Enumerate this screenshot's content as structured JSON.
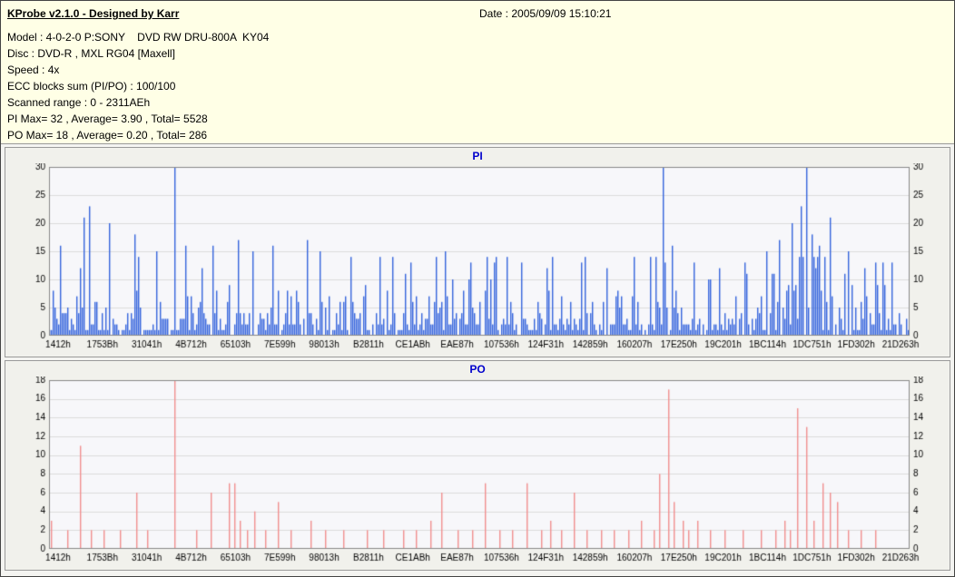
{
  "header": {
    "app_title": "KProbe v2.1.0 - Designed by Karr",
    "date_label": "Date : 2005/09/09 15:10:21",
    "info": [
      "Model : 4-0-2-0 P:SONY    DVD RW DRU-800A  KY04",
      "Disc : DVD-R , MXL RG04 [Maxell]",
      "Speed : 4x",
      "ECC blocks sum (PI/PO) : 100/100",
      "Scanned range : 0 - 2311AEh",
      "PI Max= 32 , Average= 3.90 , Total= 5528",
      "PO Max= 18 , Average= 0.20 , Total= 286"
    ]
  },
  "colors": {
    "header_bg": "#ffffe6",
    "panel_bg": "#f1f1ec",
    "chart_title": "#0000cc",
    "pi_bars": "#3565dd",
    "po_bars": "#f28f8f",
    "grid": "#dcdcdc",
    "plot_bg": "#f7f7fa"
  },
  "chart_data": [
    {
      "id": "pi",
      "type": "bar",
      "title": "PI",
      "ylim": [
        0,
        30
      ],
      "yticks": [
        0,
        5,
        10,
        15,
        20,
        25,
        30
      ],
      "x_tick_labels": [
        "1412h",
        "1753Bh",
        "31041h",
        "4B712h",
        "65103h",
        "7E599h",
        "98013h",
        "B2811h",
        "CE1ABh",
        "EAE87h",
        "107536h",
        "124F31h",
        "142859h",
        "160207h",
        "17E250h",
        "19C201h",
        "1BC114h",
        "1DC751h",
        "1FD302h",
        "21D263h"
      ],
      "stats": {
        "max": 32,
        "average": 3.9,
        "total": 5528
      },
      "bar_color": "#3565dd",
      "plot_bg": "#f7f7fa",
      "grid_color": "#dcdcdc",
      "grid": "horizontal",
      "legend": "none",
      "render": {
        "mode": "noise",
        "seed": 1337,
        "bar_pitch": 2,
        "noise_mean": 3.6,
        "noise_clamp": 14,
        "regions": [
          {
            "from": 0.0,
            "to": 0.06,
            "gain": 1.3
          },
          {
            "from": 0.08,
            "to": 0.13,
            "gain": 1.2
          },
          {
            "from": 0.695,
            "to": 0.735,
            "gain": 1.3
          },
          {
            "from": 0.84,
            "to": 0.94,
            "gain": 1.6
          }
        ]
      },
      "spikes": [
        [
          0.012,
          16
        ],
        [
          0.04,
          21
        ],
        [
          0.046,
          23
        ],
        [
          0.07,
          20
        ],
        [
          0.1,
          18
        ],
        [
          0.125,
          15
        ],
        [
          0.145,
          32
        ],
        [
          0.158,
          16
        ],
        [
          0.19,
          16
        ],
        [
          0.22,
          17
        ],
        [
          0.236,
          15
        ],
        [
          0.26,
          16
        ],
        [
          0.3,
          17
        ],
        [
          0.316,
          15
        ],
        [
          0.35,
          14
        ],
        [
          0.4,
          14
        ],
        [
          0.42,
          13
        ],
        [
          0.46,
          15
        ],
        [
          0.49,
          13
        ],
        [
          0.52,
          14
        ],
        [
          0.55,
          13
        ],
        [
          0.58,
          12
        ],
        [
          0.62,
          13
        ],
        [
          0.65,
          12
        ],
        [
          0.68,
          14
        ],
        [
          0.715,
          30
        ],
        [
          0.726,
          16
        ],
        [
          0.75,
          13
        ],
        [
          0.78,
          12
        ],
        [
          0.81,
          13
        ],
        [
          0.835,
          15
        ],
        [
          0.85,
          17
        ],
        [
          0.865,
          20
        ],
        [
          0.876,
          23
        ],
        [
          0.882,
          31
        ],
        [
          0.888,
          18
        ],
        [
          0.896,
          16
        ],
        [
          0.91,
          21
        ],
        [
          0.93,
          15
        ],
        [
          0.95,
          12
        ],
        [
          0.97,
          13
        ]
      ]
    },
    {
      "id": "po",
      "type": "bar",
      "title": "PO",
      "ylim": [
        0,
        18
      ],
      "yticks": [
        0,
        2,
        4,
        6,
        8,
        10,
        12,
        14,
        16,
        18
      ],
      "x_tick_labels": [
        "1412h",
        "1753Bh",
        "31041h",
        "4B712h",
        "65103h",
        "7E599h",
        "98013h",
        "B2811h",
        "CE1ABh",
        "EAE87h",
        "107536h",
        "124F31h",
        "142859h",
        "160207h",
        "17E250h",
        "19C201h",
        "1BC114h",
        "1DC751h",
        "1FD302h",
        "21D263h"
      ],
      "stats": {
        "max": 18,
        "average": 0.2,
        "total": 286
      },
      "bar_color": "#f28f8f",
      "plot_bg": "#f7f7fa",
      "grid_color": "#dcdcdc",
      "grid": "horizontal",
      "legend": "none",
      "render": {
        "mode": "sparse",
        "bar_pitch": 2
      },
      "bars": [
        [
          0.003,
          3
        ],
        [
          0.021,
          2
        ],
        [
          0.035,
          11
        ],
        [
          0.048,
          2
        ],
        [
          0.064,
          2
        ],
        [
          0.083,
          2
        ],
        [
          0.102,
          6
        ],
        [
          0.115,
          2
        ],
        [
          0.146,
          18
        ],
        [
          0.171,
          2
        ],
        [
          0.188,
          6
        ],
        [
          0.209,
          7
        ],
        [
          0.215,
          7
        ],
        [
          0.221,
          3
        ],
        [
          0.23,
          2
        ],
        [
          0.238,
          4
        ],
        [
          0.251,
          2
        ],
        [
          0.267,
          5
        ],
        [
          0.281,
          2
        ],
        [
          0.305,
          3
        ],
        [
          0.321,
          2
        ],
        [
          0.342,
          2
        ],
        [
          0.369,
          2
        ],
        [
          0.39,
          2
        ],
        [
          0.412,
          2
        ],
        [
          0.428,
          2
        ],
        [
          0.444,
          3
        ],
        [
          0.457,
          6
        ],
        [
          0.476,
          2
        ],
        [
          0.492,
          2
        ],
        [
          0.508,
          7
        ],
        [
          0.524,
          2
        ],
        [
          0.54,
          2
        ],
        [
          0.556,
          7
        ],
        [
          0.572,
          2
        ],
        [
          0.583,
          3
        ],
        [
          0.596,
          2
        ],
        [
          0.61,
          6
        ],
        [
          0.626,
          2
        ],
        [
          0.642,
          2
        ],
        [
          0.658,
          2
        ],
        [
          0.674,
          2
        ],
        [
          0.69,
          3
        ],
        [
          0.703,
          2
        ],
        [
          0.711,
          8
        ],
        [
          0.72,
          17
        ],
        [
          0.728,
          5
        ],
        [
          0.737,
          3
        ],
        [
          0.745,
          2
        ],
        [
          0.754,
          3
        ],
        [
          0.77,
          2
        ],
        [
          0.786,
          2
        ],
        [
          0.807,
          2
        ],
        [
          0.829,
          2
        ],
        [
          0.845,
          2
        ],
        [
          0.856,
          3
        ],
        [
          0.863,
          2
        ],
        [
          0.872,
          15
        ],
        [
          0.882,
          13
        ],
        [
          0.891,
          3
        ],
        [
          0.901,
          7
        ],
        [
          0.909,
          6
        ],
        [
          0.917,
          5
        ],
        [
          0.93,
          2
        ],
        [
          0.946,
          2
        ],
        [
          0.962,
          2
        ]
      ]
    }
  ]
}
